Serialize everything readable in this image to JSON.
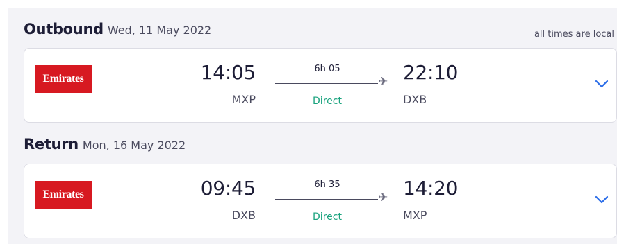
{
  "timezone_note": "all times are local",
  "legs": [
    {
      "title": "Outbound",
      "date": "Wed, 11 May 2022",
      "airline": "Emirates",
      "departure_time": "14:05",
      "departure_airport": "MXP",
      "duration": "6h 05",
      "stops": "Direct",
      "arrival_time": "22:10",
      "arrival_airport": "DXB"
    },
    {
      "title": "Return",
      "date": "Mon, 16 May 2022",
      "airline": "Emirates",
      "departure_time": "09:45",
      "departure_airport": "DXB",
      "duration": "6h 35",
      "stops": "Direct",
      "arrival_time": "14:20",
      "arrival_airport": "MXP"
    }
  ],
  "colors": {
    "brand_red": "#d71921",
    "direct_green": "#1aa37e",
    "chevron_blue": "#2b6de8",
    "text_dark": "#1d1d36"
  },
  "icons": [
    "plane-icon",
    "chevron-down-icon"
  ]
}
